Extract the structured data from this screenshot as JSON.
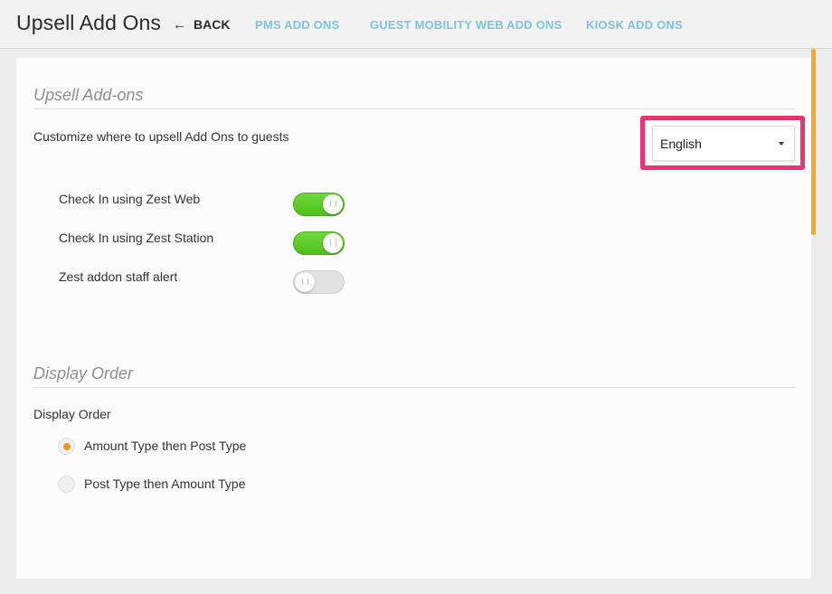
{
  "header": {
    "title": "Upsell Add Ons",
    "back_label": "BACK",
    "tabs": [
      {
        "label": "PMS ADD ONS"
      },
      {
        "label": "GUEST MOBILITY WEB ADD ONS"
      },
      {
        "label": "KIOSK ADD ONS"
      }
    ]
  },
  "upsell_section": {
    "title": "Upsell Add-ons",
    "description": "Customize where to upsell Add Ons to guests",
    "language_select": {
      "selected": "English"
    },
    "toggles": [
      {
        "label": "Check In using Zest Web",
        "on": true
      },
      {
        "label": "Check In using Zest Station",
        "on": true
      },
      {
        "label": "Zest addon staff alert",
        "on": false
      }
    ]
  },
  "display_order_section": {
    "title": "Display Order",
    "field_label": "Display Order",
    "options": [
      {
        "label": "Amount Type then Post Type",
        "selected": true
      },
      {
        "label": "Post Type then Amount Type",
        "selected": false
      }
    ]
  },
  "colors": {
    "tab_link": "#7ec3de",
    "toggle_on": "#5cc92a",
    "highlight_border": "#f0306f",
    "radio_selected": "#f5941f",
    "scrollbar": "#f7a823"
  }
}
